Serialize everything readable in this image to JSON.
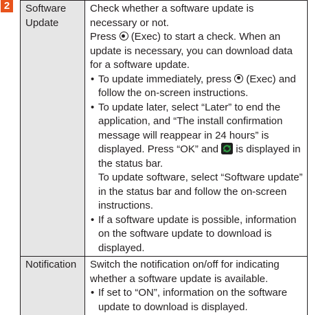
{
  "step": {
    "number": "2",
    "badge_color": "#e8531c"
  },
  "rows": [
    {
      "label": "Software Update",
      "intro": [
        "Check whether a software update is necessary or not.",
        "Press",
        "(Exec) to start a check. When an update is necessary, you can download data for a software update."
      ],
      "bullets": [
        {
          "before": "To update immediately, press",
          "after": "(Exec) and follow the on-screen instructions."
        },
        {
          "text_before_icon": "To update later, select “Later” to end the application, and “The install confirmation message will reappear in 24 hours” is displayed. Press “OK” and",
          "text_after_icon": "is displayed in the status bar.",
          "continuation": "To update software, select “Software update” in the status bar and follow the on-screen instructions."
        },
        {
          "text": "If a software update is possible, information on the software update to download is displayed."
        }
      ]
    },
    {
      "label": "Notification",
      "intro": [
        "Switch the notification on/off for indicating whether a software update is available."
      ],
      "bullets": [
        {
          "text": "If set to “ON”, information on the software update to download is displayed."
        }
      ]
    }
  ],
  "bullet_glyph": "•",
  "icons": {
    "exec_key": "exec-button-icon",
    "status_update": "software-update-status-icon"
  },
  "colors": {
    "label_background": "#e6e6e6",
    "text": "#231f20",
    "icon_green": "#2f9e44"
  }
}
